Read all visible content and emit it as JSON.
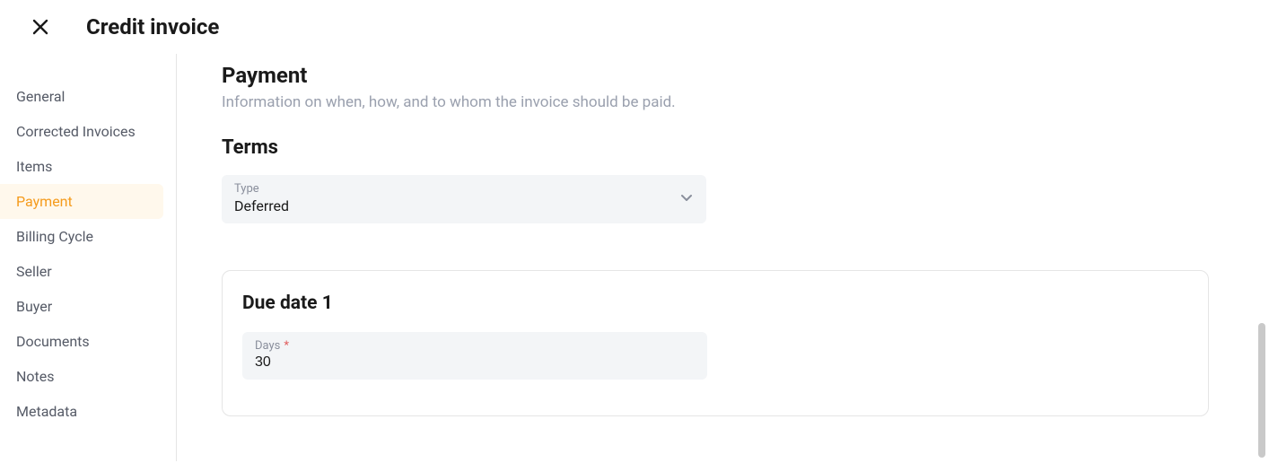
{
  "header": {
    "title": "Credit invoice"
  },
  "sidebar": {
    "items": [
      {
        "label": "General",
        "active": false
      },
      {
        "label": "Corrected Invoices",
        "active": false
      },
      {
        "label": "Items",
        "active": false
      },
      {
        "label": "Payment",
        "active": true
      },
      {
        "label": "Billing Cycle",
        "active": false
      },
      {
        "label": "Seller",
        "active": false
      },
      {
        "label": "Buyer",
        "active": false
      },
      {
        "label": "Documents",
        "active": false
      },
      {
        "label": "Notes",
        "active": false
      },
      {
        "label": "Metadata",
        "active": false
      }
    ]
  },
  "main": {
    "payment": {
      "title": "Payment",
      "description": "Information on when, how, and to whom the invoice should be paid."
    },
    "terms": {
      "title": "Terms",
      "type_label": "Type",
      "type_value": "Deferred"
    },
    "due_date": {
      "title": "Due date 1",
      "days_label": "Days",
      "days_value": "30"
    }
  }
}
